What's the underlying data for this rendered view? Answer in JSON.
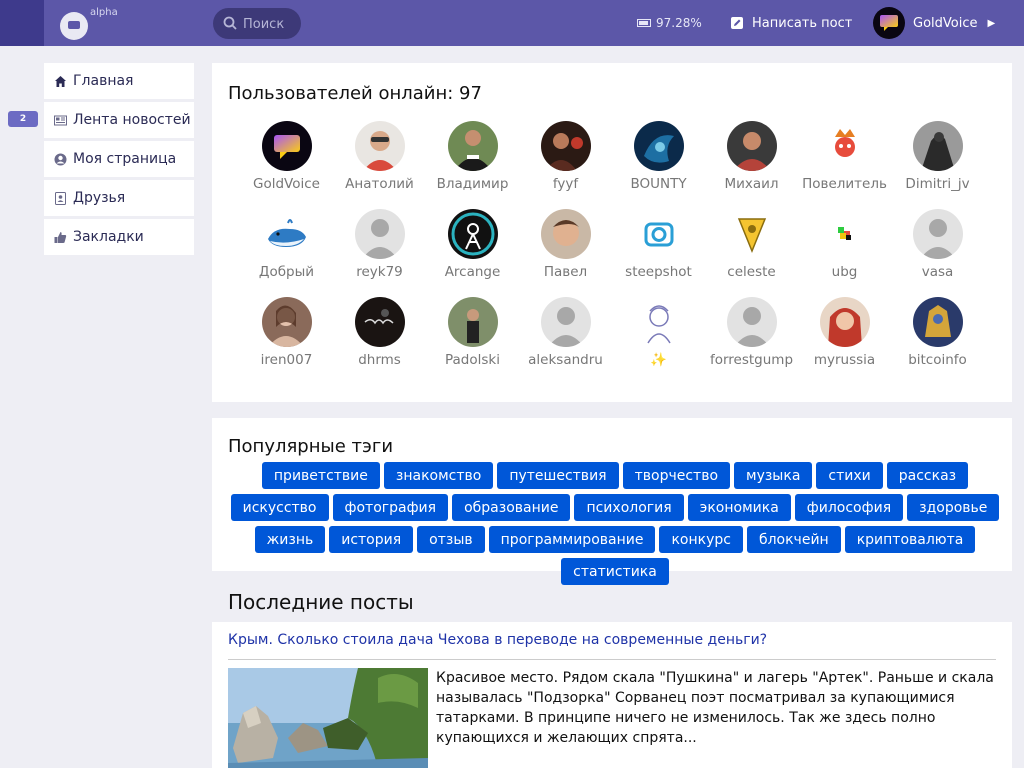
{
  "header": {
    "logo_label": "alpha",
    "search_placeholder": "Поиск",
    "power_value": "97.28%",
    "write_post_label": "Написать пост",
    "username": "GoldVoice"
  },
  "sidebar": {
    "items": [
      {
        "label": "Главная",
        "icon": "home-icon"
      },
      {
        "label": "Лента новостей",
        "icon": "newspaper-icon"
      },
      {
        "label": "Моя страница",
        "icon": "user-circle-icon"
      },
      {
        "label": "Друзья",
        "icon": "contacts-icon"
      },
      {
        "label": "Закладки",
        "icon": "thumbs-up-icon"
      }
    ],
    "badge_count": "2"
  },
  "online": {
    "title": "Пользователей онлайн: 97",
    "users": [
      {
        "name": "GoldVoice"
      },
      {
        "name": "Анатолий"
      },
      {
        "name": "Владимир"
      },
      {
        "name": "fyyf"
      },
      {
        "name": "BOUNTY"
      },
      {
        "name": "Михаил"
      },
      {
        "name": "Повелитель"
      },
      {
        "name": "Dimitri_jv"
      },
      {
        "name": "Добрый"
      },
      {
        "name": "reyk79"
      },
      {
        "name": "Arcange"
      },
      {
        "name": "Павел"
      },
      {
        "name": "steepshot"
      },
      {
        "name": "celeste"
      },
      {
        "name": "ubg"
      },
      {
        "name": "vasa"
      },
      {
        "name": "iren007"
      },
      {
        "name": "dhrms"
      },
      {
        "name": "Padolski"
      },
      {
        "name": "aleksandru"
      },
      {
        "name": "✨"
      },
      {
        "name": "forrestgump"
      },
      {
        "name": "myrussia"
      },
      {
        "name": "bitcoinfo"
      }
    ]
  },
  "tags": {
    "title": "Популярные тэги",
    "items": [
      "приветствие",
      "знакомство",
      "путешествия",
      "творчество",
      "музыка",
      "стихи",
      "рассказ",
      "искусство",
      "фотография",
      "образование",
      "психология",
      "экономика",
      "философия",
      "здоровье",
      "жизнь",
      "история",
      "отзыв",
      "программирование",
      "конкурс",
      "блокчейн",
      "криптовалюта",
      "статистика"
    ],
    "color": "#0057d8"
  },
  "posts": {
    "title": "Последние посты",
    "items": [
      {
        "title": "Крым. Сколько стоила дача Чехова в переводе на современные деньги?",
        "excerpt": "Красивое место. Рядом скала \"Пушкина\" и лагерь \"Артек\". Раньше и скала называлась \"Подзорка\" Сорванец поэт посматривал за купающимися татарками. В принципе ничего не изменилось. Так же здесь полно купающихся и желающих спрята..."
      }
    ]
  },
  "colors": {
    "header_bg": "#5c57a8",
    "header_dark": "#3e3a8c",
    "link": "#1f33a8",
    "page_bg": "#eeeef4"
  }
}
